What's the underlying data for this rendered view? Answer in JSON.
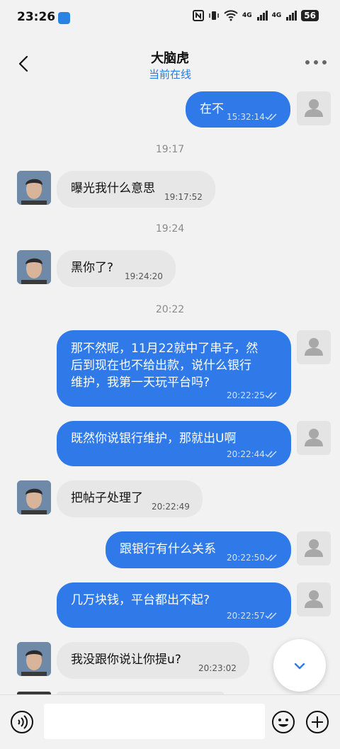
{
  "status_bar": {
    "time": "23:26",
    "network_1": "4G",
    "network_2": "4G",
    "battery": "56",
    "icons": [
      "app-icon",
      "nfc-icon",
      "vibrate-icon",
      "wifi-icon",
      "signal-icon",
      "signal-icon",
      "battery-icon"
    ]
  },
  "header": {
    "title": "大脑虎",
    "subtitle": "当前在线"
  },
  "messages": [
    {
      "side": "out",
      "text": "在不",
      "time": "15:32:14"
    },
    {
      "divider": "19:17"
    },
    {
      "side": "in",
      "text": "曝光我什么意思",
      "time": "19:17:52"
    },
    {
      "divider": "19:24"
    },
    {
      "side": "in",
      "text": "黑你了?",
      "time": "19:24:20"
    },
    {
      "divider": "20:22"
    },
    {
      "side": "out",
      "lines": [
        "那不然呢，11月22就中了串子，然",
        "后到现在也不给出款，说什么银行",
        "维护，我第一天玩平台吗?"
      ],
      "time": "20:22:25"
    },
    {
      "side": "out",
      "text": "既然你说银行维护，那就出U啊",
      "time": "20:22:44"
    },
    {
      "side": "in",
      "text": "把帖子处理了",
      "time": "20:22:49"
    },
    {
      "side": "out",
      "text": "跟银行有什么关系",
      "time": "20:22:50"
    },
    {
      "side": "out",
      "text": "几万块钱，平台都出不起?",
      "time": "20:22:57"
    },
    {
      "side": "in",
      "text": "我没跟你说让你提u?",
      "time": "20:23:02"
    }
  ],
  "colors": {
    "accent": "#2f7ae8",
    "incoming_bubble": "#e7e7e7",
    "background": "#f2f2f2"
  }
}
